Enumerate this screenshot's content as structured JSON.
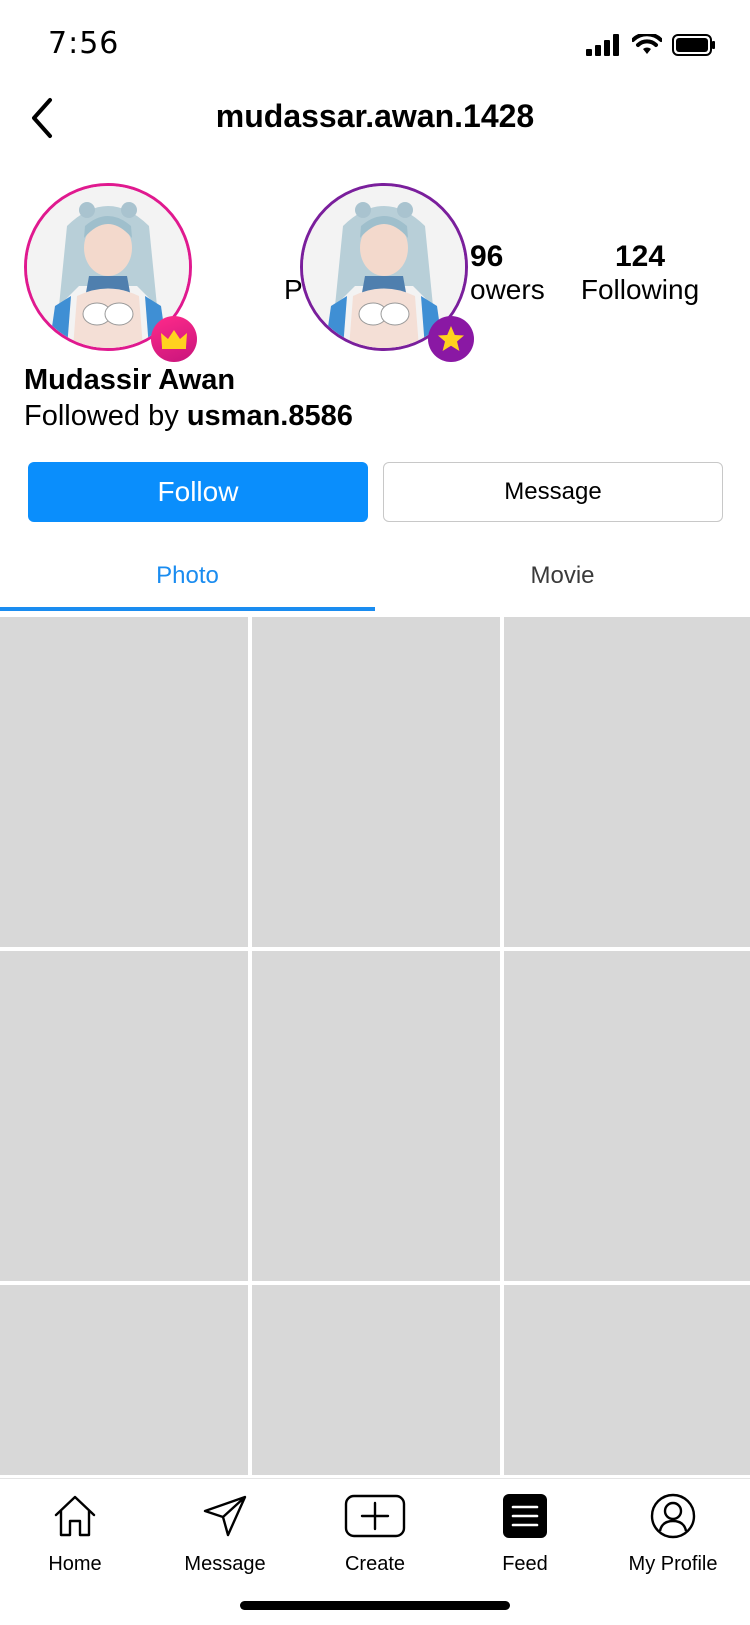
{
  "status": {
    "time": "7:56"
  },
  "header": {
    "title": "mudassar.awan.1428"
  },
  "stats": {
    "posts_label": "P",
    "followers_num": "96",
    "followers_label": "owers",
    "following_num": "124",
    "following_label": "Following"
  },
  "profile": {
    "name": "Mudassir Awan",
    "followed_by_prefix": "Followed by ",
    "followed_by_user": "usman.8586"
  },
  "actions": {
    "follow_label": "Follow",
    "message_label": "Message"
  },
  "tabs": [
    {
      "label": "Photo",
      "active": true
    },
    {
      "label": "Movie",
      "active": false
    }
  ],
  "grid": {
    "cells": 9
  },
  "colors": {
    "accent": "#0a8efc",
    "tab_active": "#1a8cf0",
    "crown_badge": "#e0198f",
    "star_badge": "#8a18a4",
    "placeholder": "#d8d8d8"
  },
  "nav": [
    {
      "label": "Home",
      "icon": "home-icon"
    },
    {
      "label": "Message",
      "icon": "paper-plane-icon"
    },
    {
      "label": "Create",
      "icon": "plus-square-icon"
    },
    {
      "label": "Feed",
      "icon": "feed-list-icon"
    },
    {
      "label": "My Profile",
      "icon": "profile-icon"
    }
  ]
}
